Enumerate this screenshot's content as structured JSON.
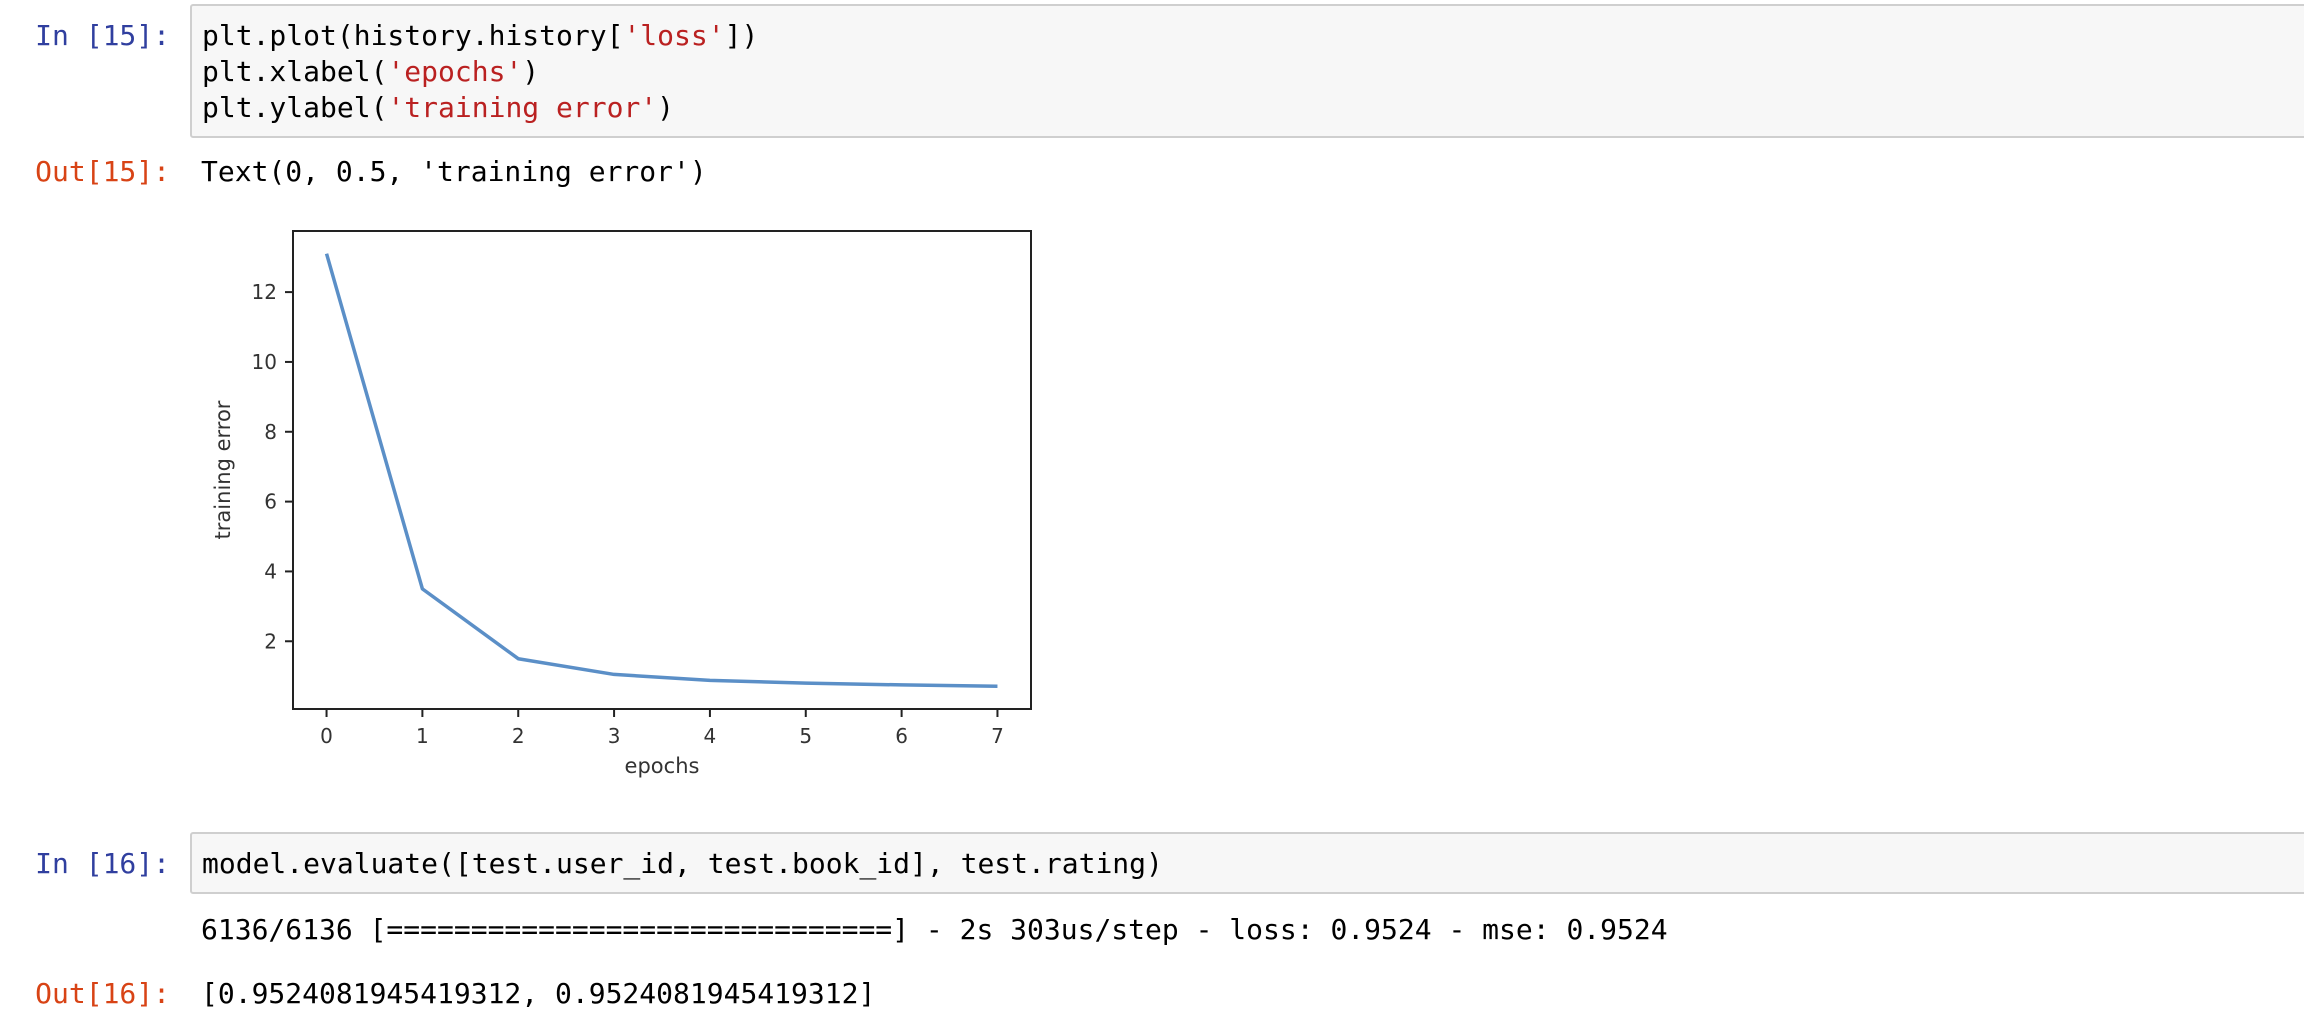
{
  "cell15": {
    "in_prompt": "In [15]:",
    "code": {
      "l1_a": "plt.plot(history.history[",
      "l1_s": "'loss'",
      "l1_b": "])",
      "l2_a": "plt.xlabel(",
      "l2_s": "'epochs'",
      "l2_b": ")",
      "l3_a": "plt.ylabel(",
      "l3_s": "'training error'",
      "l3_b": ")"
    },
    "out_prompt": "Out[15]:",
    "out_text": "Text(0, 0.5, 'training error')"
  },
  "cell16": {
    "in_prompt": "In [16]:",
    "code": "model.evaluate([test.user_id, test.book_id], test.rating)",
    "stdout": "6136/6136 [==============================] - 2s 303us/step - loss: 0.9524 - mse: 0.9524",
    "out_prompt": "Out[16]:",
    "out_text": "[0.9524081945419312, 0.9524081945419312]"
  },
  "colors": {
    "in_prompt": "#303f9f",
    "out_prompt": "#d84315",
    "string": "#ba2121",
    "line": "#5b8fc7"
  },
  "chart_data": {
    "type": "line",
    "title": "",
    "xlabel": "epochs",
    "ylabel": "training error",
    "x": [
      0,
      1,
      2,
      3,
      4,
      5,
      6,
      7
    ],
    "series": [
      {
        "values": [
          13.1,
          3.5,
          1.5,
          1.05,
          0.88,
          0.8,
          0.75,
          0.71
        ]
      }
    ],
    "xlim": [
      -0.35,
      7.35
    ],
    "ylim": [
      0.06,
      13.75
    ],
    "xticks": [
      "0",
      "1",
      "2",
      "3",
      "4",
      "5",
      "6",
      "7"
    ],
    "yticks": [
      "2",
      "4",
      "6",
      "8",
      "10",
      "12"
    ],
    "grid": false
  }
}
